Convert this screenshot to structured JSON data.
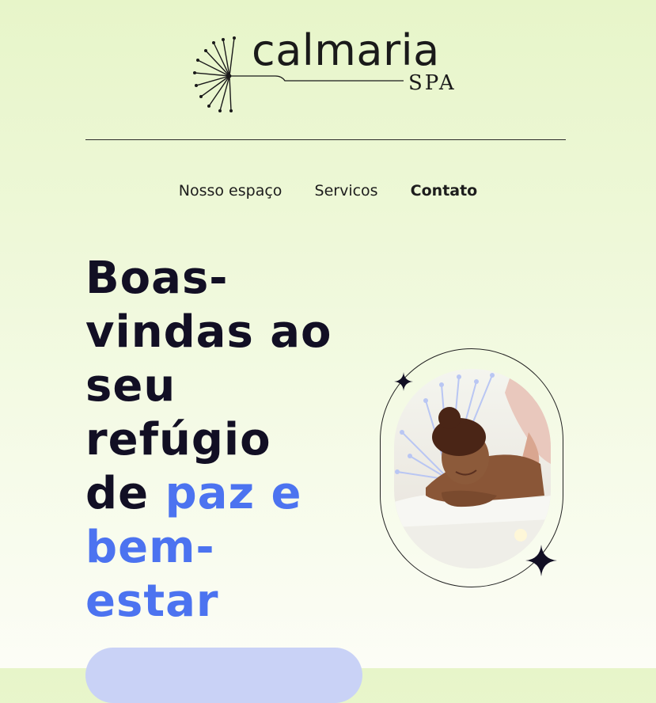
{
  "brand": {
    "name": "calmaria",
    "subtitle": "SPA"
  },
  "nav": {
    "items": [
      {
        "label": "Nosso espaço",
        "active": false
      },
      {
        "label": "Servicos",
        "active": false
      },
      {
        "label": "Contato",
        "active": true
      }
    ]
  },
  "hero": {
    "title_line1": "Boas-",
    "title_line2": "vindas ao",
    "title_line3": "seu",
    "title_line4": "refúgio",
    "title_line5_plain": "de ",
    "title_line5_accent": "paz e",
    "title_line6": "bem-",
    "title_line7": "estar",
    "image_alt": "Mulher recebendo massagem"
  },
  "colors": {
    "accent": "#4c73f0",
    "dark": "#120f24",
    "cta": "#c9d2f6"
  },
  "icons": {
    "logo_mark": "dandelion-icon",
    "sparkle": "sparkle-icon"
  }
}
